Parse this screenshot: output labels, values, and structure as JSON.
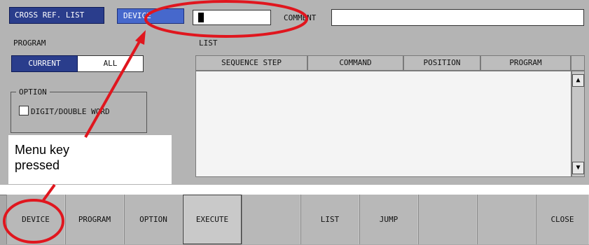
{
  "header": {
    "title": "CROSS REF. LIST",
    "device_tab": "DEVICE",
    "comment_label": "COMMENT"
  },
  "program": {
    "label": "PROGRAM",
    "options": [
      "CURRENT",
      "ALL"
    ],
    "selected": "CURRENT"
  },
  "option": {
    "group_label": "OPTION",
    "checkbox_label": "DIGIT/DOUBLE WORD",
    "checked": false
  },
  "list": {
    "label": "LIST",
    "columns": [
      "SEQUENCE STEP",
      "COMMAND",
      "POSITION",
      "PROGRAM"
    ],
    "rows": []
  },
  "callout": {
    "line1": "Menu key",
    "line2": "pressed"
  },
  "function_keys": [
    "DEVICE",
    "PROGRAM",
    "OPTION",
    "EXECUTE",
    "",
    "LIST",
    "JUMP",
    "",
    "",
    "CLOSE"
  ],
  "colors": {
    "highlight": "#e0161e",
    "selected_blue": "#2a3d8c",
    "tab_blue": "#4668cc"
  }
}
